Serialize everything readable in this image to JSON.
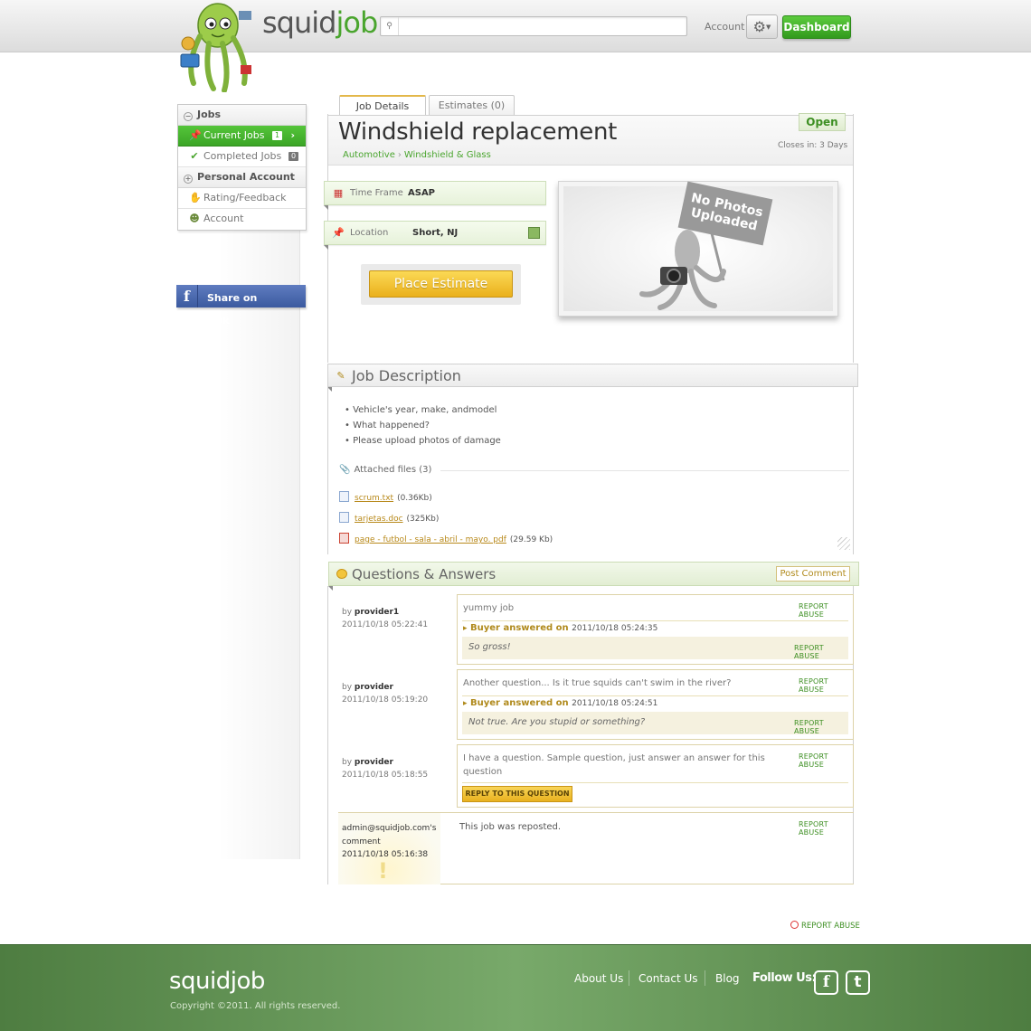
{
  "brand": {
    "name_a": "squid",
    "name_b": "job"
  },
  "header": {
    "search_placeholder": "",
    "account_label": "Account",
    "dashboard_label": "Dashboard"
  },
  "sidebar": {
    "jobs_section": "Jobs",
    "current_jobs": {
      "label": "Current Jobs",
      "count": "1"
    },
    "completed_jobs": {
      "label": "Completed Jobs",
      "count": "0"
    },
    "personal_section": "Personal Account",
    "rating": "Rating/Feedback",
    "account": "Account",
    "share_facebook": "Share on Facebook"
  },
  "tabs": {
    "details": "Job Details",
    "estimates": "Estimates (0)"
  },
  "job": {
    "title": "Windshield replacement",
    "category": "Automotive",
    "subcategory": "Windshield & Glass",
    "status": "Open",
    "closes_in": "Closes in: 3 Days",
    "time_frame_label": "Time Frame",
    "time_frame_value": "ASAP",
    "location_label": "Location",
    "location_value": "Short, NJ",
    "place_estimate": "Place Estimate",
    "no_photos_1": "No Photos",
    "no_photos_2": "Uploaded"
  },
  "description": {
    "heading": "Job Description",
    "bullets": [
      "Vehicle's year, make, andmodel",
      "What happened?",
      "Please upload photos of damage"
    ],
    "attached_label": "Attached files (3)",
    "files": [
      {
        "name": "scrum.txt",
        "size": "(0.36Kb)"
      },
      {
        "name": "tarjetas.doc",
        "size": "(325Kb)"
      },
      {
        "name": "page - futbol - sala - abril - mayo. pdf",
        "size": "(29.59 Kb)"
      }
    ]
  },
  "qa": {
    "heading": "Questions & Answers",
    "post_comment": "Post Comment",
    "report_abuse": "REPORT ABUSE",
    "by": "by",
    "buyer_answered": "Buyer answered on",
    "reply_label": "REPLY TO THIS QUESTION",
    "items": [
      {
        "author": "provider1",
        "date": "2011/10/18 05:22:41",
        "question": "yummy job",
        "answer_date": "2011/10/18 05:24:35",
        "answer": "So gross!"
      },
      {
        "author": "provider",
        "date": "2011/10/18 05:19:20",
        "question": "Another question... Is it true squids can't swim in the river?",
        "answer_date": "2011/10/18 05:24:51",
        "answer": "Not true. Are you stupid or something?"
      },
      {
        "author": "provider",
        "date": "2011/10/18 05:18:55",
        "question": "I have a question. Sample question, just answer an answer for this question"
      }
    ],
    "admin": {
      "name": "admin@squidjob.com's",
      "suffix": "comment",
      "date": "2011/10/18 05:16:38",
      "text": "This job was reposted."
    }
  },
  "footer": {
    "logo": "squidjob",
    "copyright": "Copyright ©2011. All rights reserved.",
    "about": "About Us",
    "contact": "Contact Us",
    "blog": "Blog",
    "follow": "Follow Us:"
  },
  "colors": {
    "brand_green": "#4aa52e",
    "accent_yellow": "#eab01c",
    "footer_green": "#5f8f52"
  }
}
